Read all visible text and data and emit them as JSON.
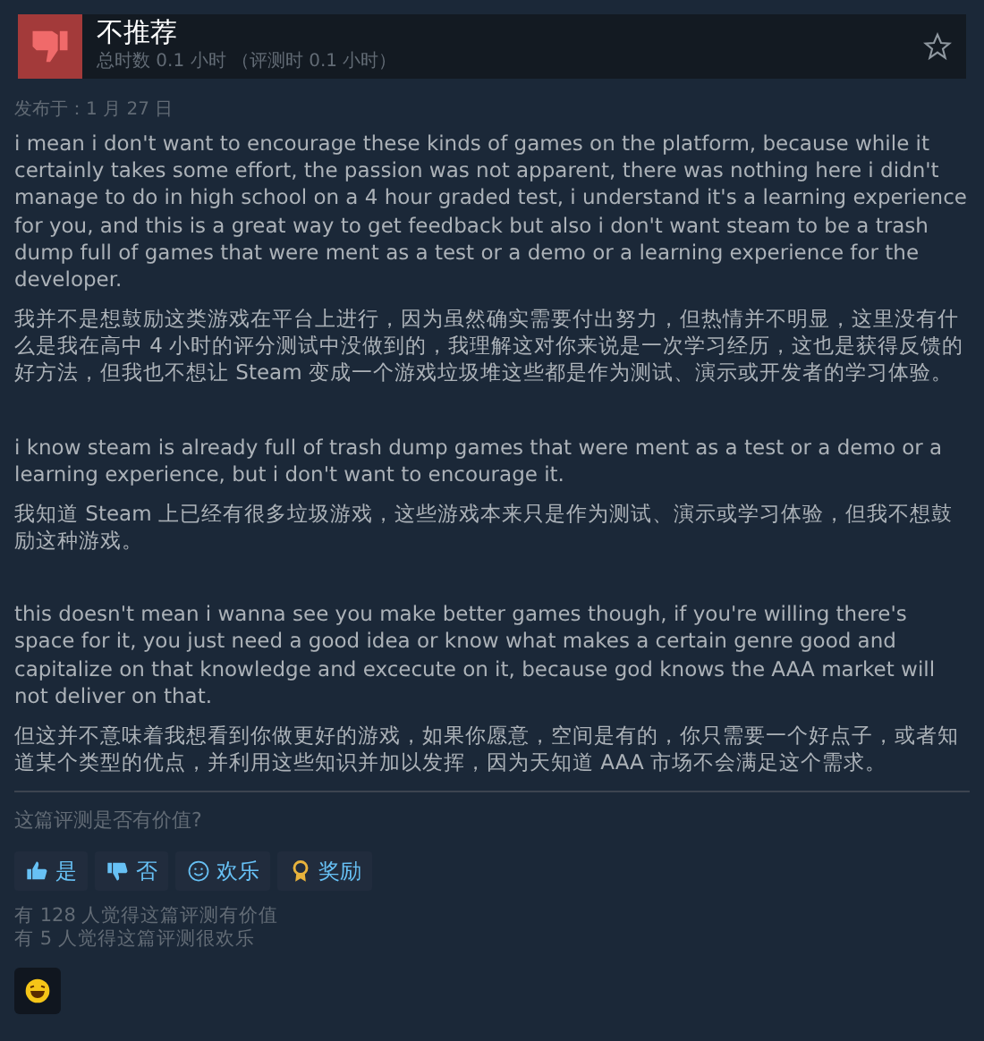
{
  "header": {
    "verdict": "不推荐",
    "playtime": "总时数 0.1 小时 （评测时 0.1 小时）"
  },
  "posted": "发布于：1 月 27 日",
  "paragraphs": [
    {
      "text": "i mean i don't want to encourage these kinds of games on the platform, because while it certainly takes some effort, the passion was not apparent, there was nothing here i didn't manage to do in high school on a 4 hour graded test, i understand it's a learning experience for you, and this is a great way to get feedback but also i don't want steam to be a trash dump full of games that were ment as a test or a demo or a learning experience for the developer."
    },
    {
      "text": "我并不是想鼓励这类游戏在平台上进行，因为虽然确实需要付出努力，但热情并不明显，这里没有什么是我在高中 4 小时的评分测试中没做到的，我理解这对你来说是一次学习经历，这也是获得反馈的好方法，但我也不想让 Steam 变成一个游戏垃圾堆这些都是作为测试、演示或开发者的学习体验。"
    },
    {
      "text": "i know steam is already full of trash dump games that were ment as a test or a demo or a learning experience, but i don't want to encourage it."
    },
    {
      "text": "我知道 Steam 上已经有很多垃圾游戏，这些游戏本来只是作为测试、演示或学习体验，但我不想鼓励这种游戏。"
    },
    {
      "text": "this doesn't mean i wanna see you make better games though, if you're willing there's space for it, you just need a good idea or know what makes a certain genre good and capitalize on that knowledge and excecute on it, because god knows the AAA market will not deliver on that."
    },
    {
      "text": "但这并不意味着我想看到你做更好的游戏，如果你愿意，空间是有的，你只需要一个好点子，或者知道某个类型的优点，并利用这些知识并加以发挥，因为天知道 AAA 市场不会满足这个需求。"
    }
  ],
  "question": "这篇评测是否有价值?",
  "buttons": [
    {
      "kind": "up",
      "label": "是"
    },
    {
      "kind": "down",
      "label": "否"
    },
    {
      "kind": "smile",
      "label": "欢乐"
    },
    {
      "kind": "award",
      "label": "奖励"
    }
  ],
  "stats": [
    "有 128 人觉得这篇评测有价值",
    "有 5 人觉得这篇评测很欢乐"
  ]
}
